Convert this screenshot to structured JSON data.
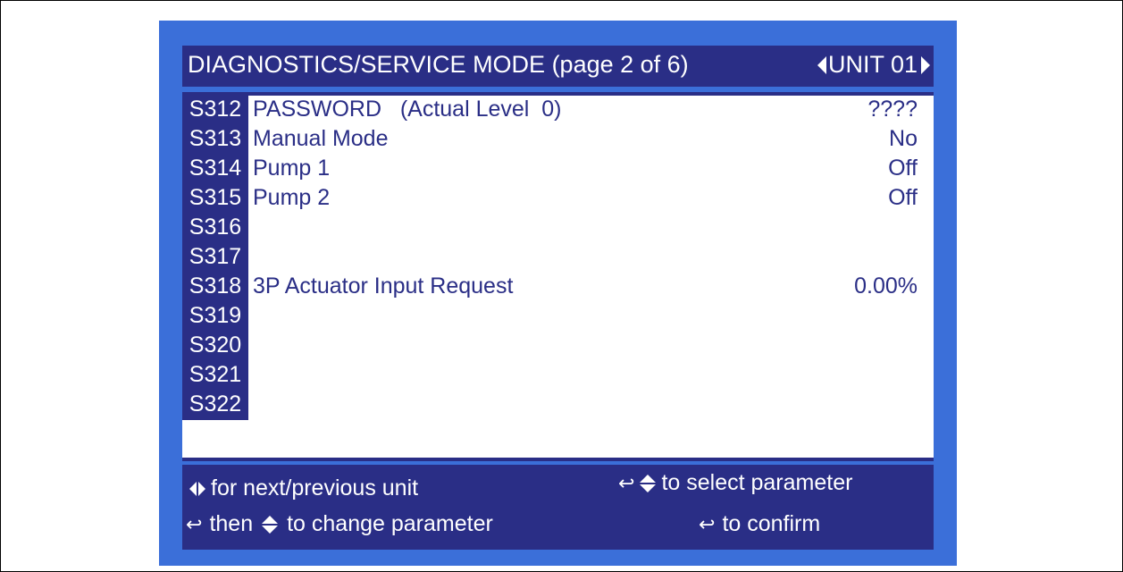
{
  "header": {
    "title": "DIAGNOSTICS/SERVICE MODE (page 2 of 6)",
    "unit_label": "UNIT 01"
  },
  "parameters": [
    {
      "code": "S312",
      "label": "PASSWORD   (Actual Level  0)",
      "value": "????"
    },
    {
      "code": "S313",
      "label": "Manual Mode",
      "value": "No"
    },
    {
      "code": "S314",
      "label": "Pump 1",
      "value": "Off"
    },
    {
      "code": "S315",
      "label": "Pump 2",
      "value": "Off"
    },
    {
      "code": "S316",
      "label": "",
      "value": ""
    },
    {
      "code": "S317",
      "label": "",
      "value": ""
    },
    {
      "code": "S318",
      "label": "3P Actuator Input Request",
      "value": "0.00%"
    },
    {
      "code": "S319",
      "label": "",
      "value": ""
    },
    {
      "code": "S320",
      "label": "",
      "value": ""
    },
    {
      "code": "S321",
      "label": "",
      "value": ""
    },
    {
      "code": "S322",
      "label": "",
      "value": ""
    }
  ],
  "footer": {
    "next_prev_unit": "for next/previous unit",
    "select_parameter": "to select parameter",
    "then_word": "then",
    "change_parameter": "to change parameter",
    "confirm": "to confirm"
  },
  "icons": {
    "enter": "enter-icon",
    "up_down": "up-down-arrows-icon",
    "left_right": "left-right-arrows-icon"
  },
  "colors": {
    "screen_background": "#3b6fd9",
    "bar_navy": "#2a2e86",
    "content_background": "#ffffff",
    "text_on_white": "#2a2e86"
  }
}
